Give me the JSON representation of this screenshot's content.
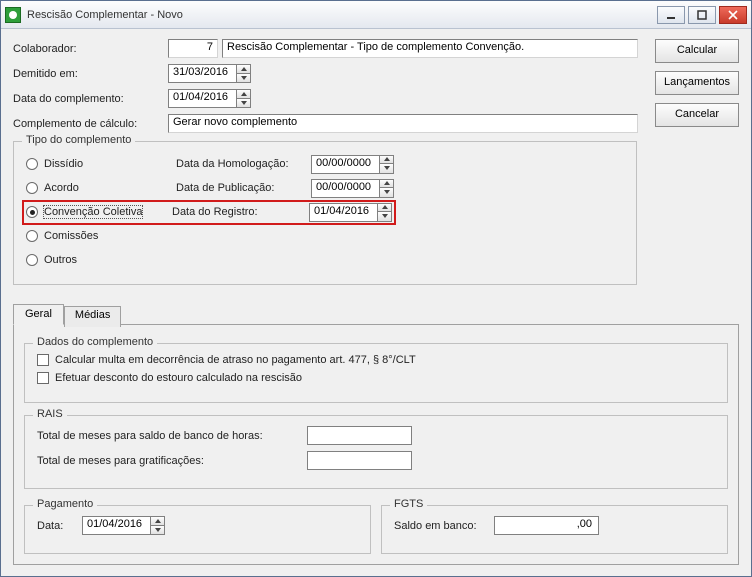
{
  "window": {
    "title": "Rescisão Complementar - Novo"
  },
  "header": {
    "colaborador_label": "Colaborador:",
    "colaborador_num": "7",
    "colaborador_desc": "Rescisão Complementar - Tipo de complemento Convenção.",
    "demitido_label": "Demitido em:",
    "demitido_date": "31/03/2016",
    "data_comp_label": "Data do complemento:",
    "data_comp_date": "01/04/2016",
    "complemento_calc_label": "Complemento de cálculo:",
    "complemento_calc_value": "Gerar novo complemento"
  },
  "buttons": {
    "calcular": "Calcular",
    "lancamentos": "Lançamentos",
    "cancelar": "Cancelar"
  },
  "tipo": {
    "legend": "Tipo do complemento",
    "dissidio": "Dissídio",
    "acordo": "Acordo",
    "convencao": "Convenção Coletiva",
    "comissoes": "Comissões",
    "outros": "Outros",
    "data_homolog_label": "Data da Homologação:",
    "data_homolog": "00/00/0000",
    "data_publi_label": "Data de Publicação:",
    "data_publi": "00/00/0000",
    "data_reg_label": "Data do Registro:",
    "data_reg": "01/04/2016"
  },
  "tabs": {
    "geral": "Geral",
    "medias": "Médias"
  },
  "dados": {
    "legend": "Dados do complemento",
    "multa": "Calcular multa em decorrência de atraso no pagamento art. 477, § 8°/CLT",
    "desconto": "Efetuar desconto do estouro calculado na rescisão"
  },
  "rais": {
    "legend": "RAIS",
    "meses_banco": "Total de meses para saldo de banco de horas:",
    "meses_grat": "Total de meses para gratificações:"
  },
  "pagamento": {
    "legend": "Pagamento",
    "data_label": "Data:",
    "data": "01/04/2016"
  },
  "fgts": {
    "legend": "FGTS",
    "saldo_label": "Saldo em banco:",
    "saldo": ",00"
  }
}
